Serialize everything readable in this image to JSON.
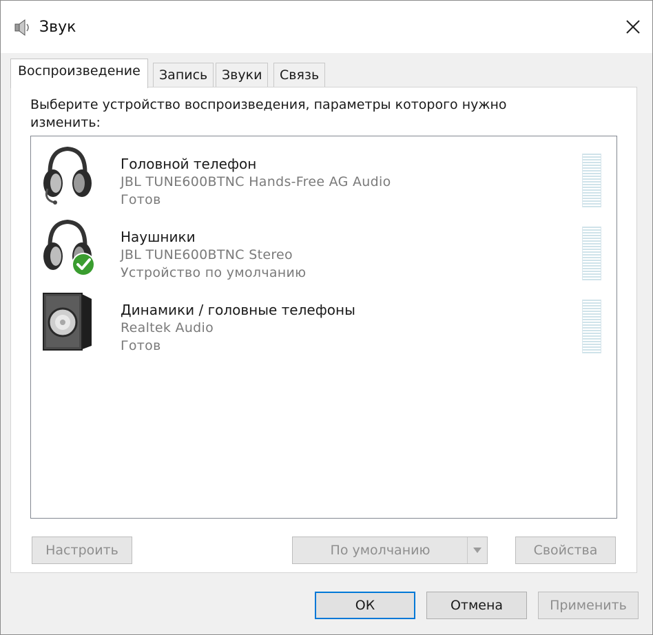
{
  "window": {
    "title": "Звук"
  },
  "tabs": [
    {
      "label": "Воспроизведение",
      "active": true
    },
    {
      "label": "Запись",
      "active": false
    },
    {
      "label": "Звуки",
      "active": false
    },
    {
      "label": "Связь",
      "active": false
    }
  ],
  "playback": {
    "instruction": "Выберите устройство воспроизведения, параметры которого нужно изменить:",
    "devices": [
      {
        "name": "Головной телефон",
        "description": "JBL TUNE600BTNC Hands-Free AG Audio",
        "status": "Готов",
        "icon": "headset-icon",
        "is_default": false
      },
      {
        "name": "Наушники",
        "description": "JBL TUNE600BTNC Stereo",
        "status": "Устройство по умолчанию",
        "icon": "headphones-icon",
        "is_default": true
      },
      {
        "name": "Динамики / головные телефоны",
        "description": "Realtek Audio",
        "status": "Готов",
        "icon": "speaker-icon",
        "is_default": false
      }
    ],
    "buttons": {
      "configure": "Настроить",
      "set_default": "По умолчанию",
      "properties": "Свойства"
    }
  },
  "footer": {
    "ok": "ОК",
    "cancel": "Отмена",
    "apply": "Применить"
  },
  "colors": {
    "accent": "#0078d7",
    "default_check": "#3a9d2f",
    "meter": "#cfe3ea"
  }
}
